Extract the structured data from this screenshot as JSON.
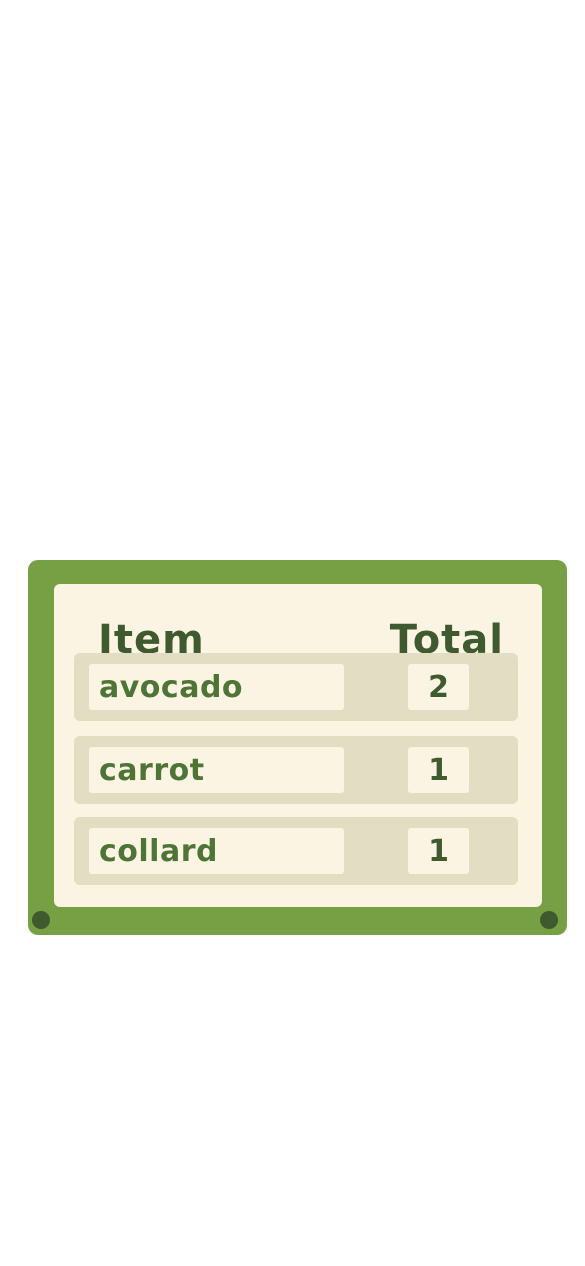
{
  "table": {
    "header": {
      "item_label": "Item",
      "total_label": "Total"
    },
    "rows": [
      {
        "item": "avocado",
        "total": "2"
      },
      {
        "item": "carrot",
        "total": "1"
      },
      {
        "item": "collard",
        "total": "1"
      }
    ]
  },
  "colors": {
    "board_green": "#779f43",
    "panel_cream": "#fbf4e3",
    "row_beige": "#e3ddc3",
    "text_dark_green": "#3f5a2f",
    "text_green": "#4e7436",
    "bolt": "#3f5a2f"
  }
}
